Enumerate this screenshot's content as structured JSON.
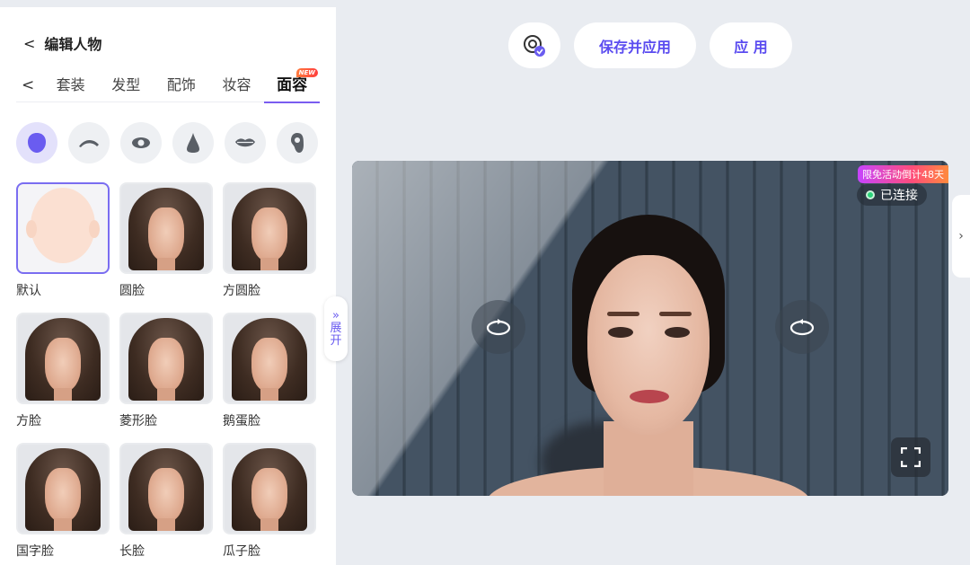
{
  "header": {
    "back_title": "编辑人物"
  },
  "tabs": [
    {
      "label": "套装"
    },
    {
      "label": "发型"
    },
    {
      "label": "配饰"
    },
    {
      "label": "妆容"
    },
    {
      "label": "面容",
      "badge": "NEW",
      "active": true
    }
  ],
  "parts": [
    "face-shape-icon",
    "eyebrow-icon",
    "eye-icon",
    "nose-icon",
    "lips-icon",
    "ear-icon"
  ],
  "faces": [
    {
      "label": "默认"
    },
    {
      "label": "圆脸"
    },
    {
      "label": "方圆脸"
    },
    {
      "label": "方脸"
    },
    {
      "label": "菱形脸"
    },
    {
      "label": "鹅蛋脸"
    },
    {
      "label": "国字脸"
    },
    {
      "label": "长脸"
    },
    {
      "label": "瓜子脸"
    }
  ],
  "expand": {
    "label_line1": "展",
    "label_line2": "开"
  },
  "toolbar": {
    "save_apply_label": "保存并应用",
    "apply_label": "应 用"
  },
  "preview": {
    "promo_text": "限免活动倒计48天",
    "status_text": "已连接"
  },
  "colors": {
    "accent": "#5b4cf0",
    "selected_border": "#7a6df1",
    "status_green": "#2bd37a"
  }
}
